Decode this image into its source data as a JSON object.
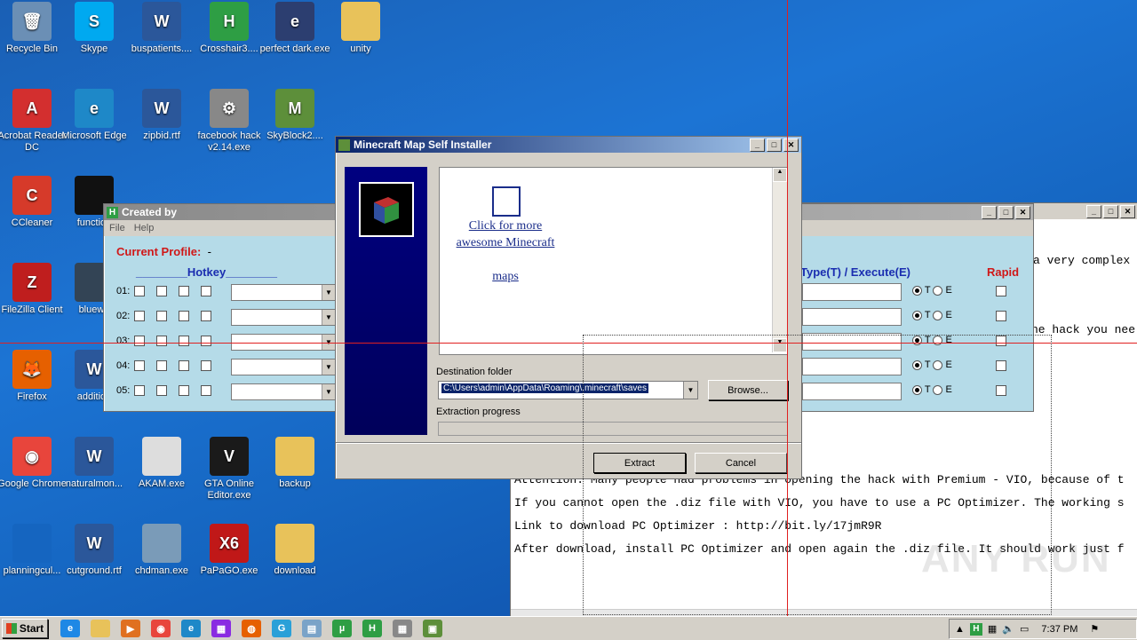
{
  "desktop_icons": [
    {
      "label": "Recycle Bin",
      "icon": "recycle-bin-icon",
      "color": "#6b8fb5",
      "glyph": "🗑"
    },
    {
      "label": "Skype",
      "icon": "skype-icon",
      "color": "#00a9f0",
      "glyph": "S"
    },
    {
      "label": "buspatients....",
      "icon": "word-doc-icon",
      "color": "#2b579a",
      "glyph": "W"
    },
    {
      "label": "Crosshair3....",
      "icon": "crosshair-app-icon",
      "color": "#2e9e44",
      "glyph": "H"
    },
    {
      "label": "perfect dark.exe",
      "icon": "perfect-dark-icon",
      "color": "#2c3e70",
      "glyph": "e"
    },
    {
      "label": "unity",
      "icon": "folder-icon",
      "color": "#e8c25a",
      "glyph": ""
    },
    {
      "label": "Acrobat Reader DC",
      "icon": "acrobat-icon",
      "color": "#d32f2f",
      "glyph": "A"
    },
    {
      "label": "Microsoft Edge",
      "icon": "edge-icon",
      "color": "#1e88c8",
      "glyph": "e"
    },
    {
      "label": "zipbid.rtf",
      "icon": "word-doc-icon",
      "color": "#2b579a",
      "glyph": "W"
    },
    {
      "label": "facebook hack v2.14.exe",
      "icon": "installer-icon",
      "color": "#888888",
      "glyph": "⚙"
    },
    {
      "label": "SkyBlock2....",
      "icon": "minecraft-icon",
      "color": "#5d8f3a",
      "glyph": "M"
    },
    {
      "label": "CCleaner",
      "icon": "ccleaner-icon",
      "color": "#d63a2a",
      "glyph": "C"
    },
    {
      "label": "function",
      "icon": "file-icon",
      "color": "#111111",
      "glyph": ""
    },
    {
      "label": "FileZilla Client",
      "icon": "filezilla-icon",
      "color": "#bf1e1e",
      "glyph": "Z"
    },
    {
      "label": "bluewe",
      "icon": "file-icon",
      "color": "#334455",
      "glyph": ""
    },
    {
      "label": "Firefox",
      "icon": "firefox-icon",
      "color": "#e66000",
      "glyph": "🦊"
    },
    {
      "label": "addition",
      "icon": "word-doc-icon",
      "color": "#2b579a",
      "glyph": "W"
    },
    {
      "label": "Google Chrome",
      "icon": "chrome-icon",
      "color": "#e8453c",
      "glyph": "◉"
    },
    {
      "label": "naturalmon...",
      "icon": "word-doc-icon",
      "color": "#2b579a",
      "glyph": "W"
    },
    {
      "label": "AKAM.exe",
      "icon": "tiger-image-icon",
      "color": "#dddddd",
      "glyph": ""
    },
    {
      "label": "GTA Online Editor.exe",
      "icon": "gta-icon",
      "color": "#1a1a1a",
      "glyph": "V"
    },
    {
      "label": "backup",
      "icon": "folder-icon",
      "color": "#e8c25a",
      "glyph": ""
    },
    {
      "label": "planningcul...",
      "icon": "file-icon",
      "color": "#1565c0",
      "glyph": ""
    },
    {
      "label": "cutground.rtf",
      "icon": "word-doc-icon",
      "color": "#2b579a",
      "glyph": "W"
    },
    {
      "label": "chdman.exe",
      "icon": "exe-window-icon",
      "color": "#7a9bb8",
      "glyph": ""
    },
    {
      "label": "PaPaGO.exe",
      "icon": "papago-icon",
      "color": "#c01818",
      "glyph": "X6"
    },
    {
      "label": "download",
      "icon": "folder-icon",
      "color": "#e8c25a",
      "glyph": ""
    }
  ],
  "hotkey_window": {
    "title": "Created by",
    "menu": [
      "File",
      "Help"
    ],
    "profile_label": "Current Profile:",
    "profile_value": "-",
    "hotkey_header": "________Hotkey________",
    "rows": [
      "01:",
      "02:",
      "03:",
      "04:",
      "05:"
    ],
    "type_header": "Type(T) / Execute(E)",
    "rapid_header": "Rapid",
    "radio_t": "T",
    "radio_e": "E"
  },
  "notepad": {
    "lines_top": [
      "a very complex",
      "he hack you nee"
    ],
    "lines": [
      "Attention: Many people had problems in opening the hack with Premium - VIO, because of t",
      "If you cannot open the .diz file with VIO, you have to use a PC Optimizer. The working s",
      "Link to download  PC Optimizer : http://bit.ly/17jmR9R",
      "After download, install PC Optimizer and open again the .diz file. It should work just f"
    ]
  },
  "installer": {
    "title": "Minecraft Map Self Installer",
    "link_text": "Click for more awesome Minecraft",
    "link_text2": "maps",
    "dest_label": "Destination folder",
    "dest_value": "C:\\Users\\admin\\AppData\\Roaming\\.minecraft\\saves",
    "browse_label": "Browse...",
    "progress_label": "Extraction progress",
    "progress": 0,
    "extract_label": "Extract",
    "cancel_label": "Cancel"
  },
  "taskbar": {
    "start_label": "Start",
    "clock": "7:37 PM"
  },
  "watermark": "ANY RUN"
}
